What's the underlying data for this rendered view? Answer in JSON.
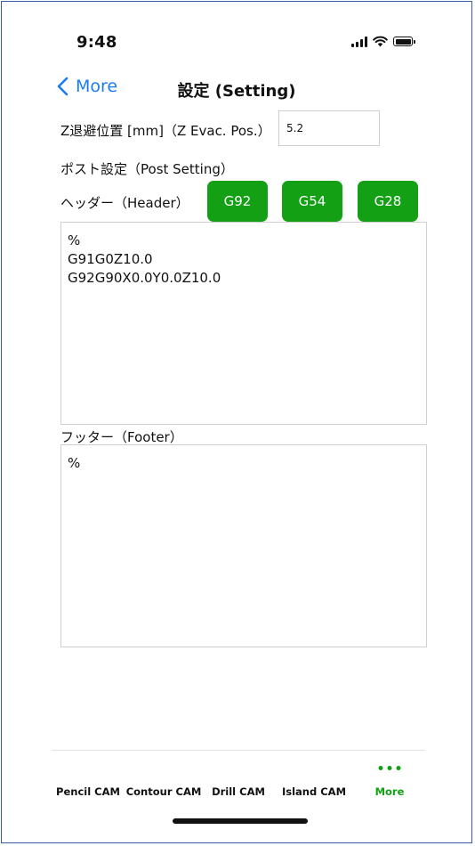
{
  "status_bar": {
    "time": "9:48"
  },
  "nav": {
    "back_label": "More",
    "title": "設定 (Setting)"
  },
  "form": {
    "z_evac_label": "Z退避位置 [mm]（Z Evac. Pos.）",
    "z_evac_value": "5.2",
    "post_setting_label": "ポスト設定（Post Setting）",
    "header_label": "ヘッダー（Header）",
    "buttons": [
      {
        "label": "G92"
      },
      {
        "label": "G54"
      },
      {
        "label": "G28"
      }
    ],
    "header_text": "%\nG91G0Z10.0\nG92G90X0.0Y0.0Z10.0",
    "footer_label": "フッター（Footer）",
    "footer_text": "%"
  },
  "tabs": [
    {
      "label": "Pencil CAM"
    },
    {
      "label": "Contour CAM"
    },
    {
      "label": "Drill CAM"
    },
    {
      "label": "Island CAM"
    },
    {
      "label": "More"
    }
  ],
  "colors": {
    "accent_green": "#13a014",
    "link_blue": "#1b7cf3",
    "frame_border": "#3b5bab"
  }
}
